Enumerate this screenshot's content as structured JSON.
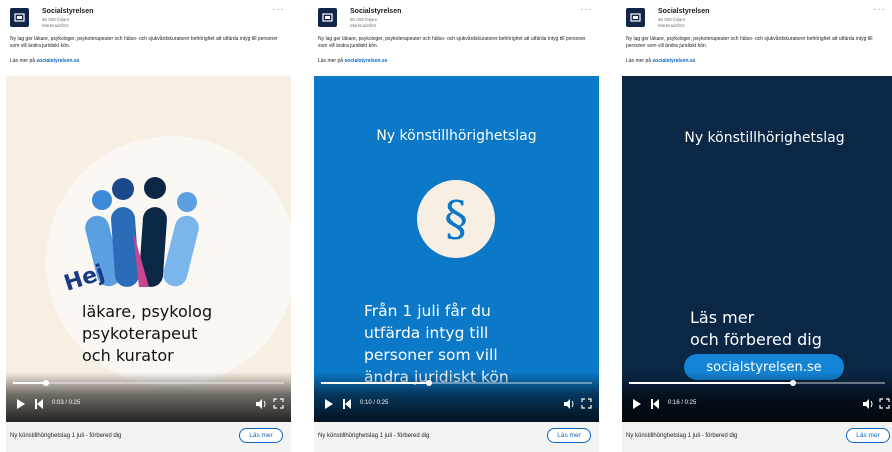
{
  "post": {
    "org": "Socialstyrelsen",
    "followers": "90 009 följare",
    "promoted": "Marknadsfört",
    "text": "Ny lag ger läkare, psykologer, psykoterapeuter och hälso- och sjukvårdskuratorer behörighet att utfärda intyg till personer som vill ändra juridiskt kön.",
    "more_prefix": "Läs mer på",
    "more_link": "socialstyrelsen.se",
    "menu": "···"
  },
  "footer": {
    "title": "Ny könstillhörighetslag 1 juli - förbered dig",
    "button": "Läs mer"
  },
  "colors": {
    "card1_bg": "#f7efe3",
    "card2_bg": "#0b78c8",
    "card3_bg": "#0b2746",
    "link": "#0a66c2",
    "pill": "#1484d6"
  },
  "cards": [
    {
      "time": "0:03 / 0:25",
      "progress": 0.12,
      "hej": "Hej",
      "lines": [
        "läkare, psykolog",
        "psykoterapeut",
        "och kurator"
      ]
    },
    {
      "time": "0:10 / 0:25",
      "progress": 0.4,
      "title": "Ny könstillhörighetslag",
      "symbol": "§",
      "lines": [
        "Från 1 juli får du",
        "utfärda intyg till",
        "personer som vill",
        "ändra juridiskt kön"
      ]
    },
    {
      "time": "0:16 / 0:25",
      "progress": 0.64,
      "title": "Ny könstillhörighetslag",
      "lines": [
        "Läs mer",
        "och förbered dig"
      ],
      "pill": "socialstyrelsen.se"
    }
  ]
}
